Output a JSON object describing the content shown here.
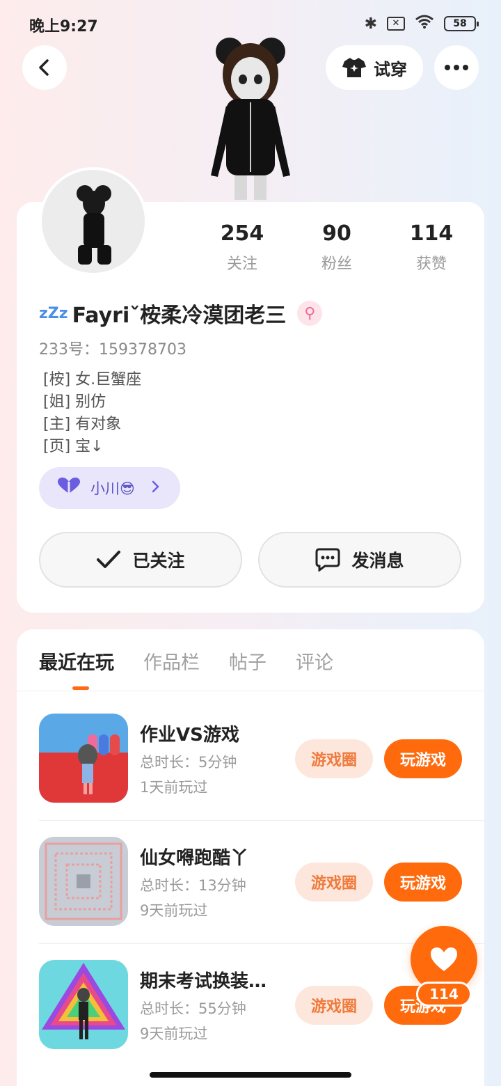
{
  "status_bar": {
    "time": "晚上9:27",
    "battery": "58"
  },
  "header": {
    "tryon_label": "试穿"
  },
  "stats": [
    {
      "value": "254",
      "label": "关注"
    },
    {
      "value": "90",
      "label": "粉丝"
    },
    {
      "value": "114",
      "label": "获赞"
    }
  ],
  "profile": {
    "zzz": "zZz",
    "name": "Fayriˇ桉柔冷漠团老三",
    "gender_symbol": "⚲",
    "uid": "233号：159378703",
    "bio": [
      "[桉] 女.巨蟹座",
      "[姐] 别仿",
      "[主] 有对象",
      "[页] 宝↓"
    ],
    "relation_name": "小川😎"
  },
  "actions": {
    "follow_label": "已关注",
    "message_label": "发消息"
  },
  "tabs": [
    "最近在玩",
    "作品栏",
    "帖子",
    "评论"
  ],
  "games": [
    {
      "title": "作业VS游戏",
      "duration": "总时长：5分钟",
      "last_played": "1天前玩过",
      "circle_label": "游戏圈",
      "play_label": "玩游戏"
    },
    {
      "title": "仙女嘚跑酷丫",
      "duration": "总时长：13分钟",
      "last_played": "9天前玩过",
      "circle_label": "游戏圈",
      "play_label": "玩游戏"
    },
    {
      "title": "期末考试换装…",
      "duration": "总时长：55分钟",
      "last_played": "9天前玩过",
      "circle_label": "游戏圈",
      "play_label": "玩游戏"
    }
  ],
  "like": {
    "count": "114"
  },
  "colors": {
    "accent": "#ff6a0d",
    "accent_light": "#fde7dc",
    "purple": "#6b5de0",
    "purple_bg": "#e9e6fb"
  }
}
